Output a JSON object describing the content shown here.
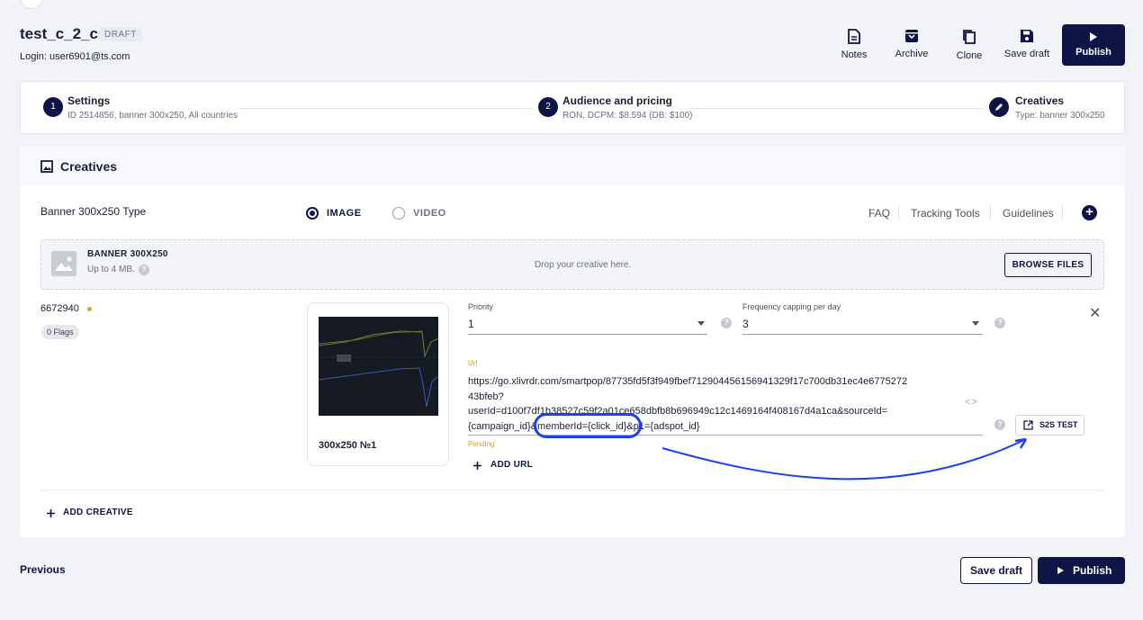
{
  "header": {
    "campaign_name": "test_c_2_c",
    "status_badge": "DRAFT",
    "login": "Login: user6901@ts.com"
  },
  "toolbar": {
    "notes": "Notes",
    "archive": "Archive",
    "clone": "Clone",
    "save_draft": "Save draft",
    "publish": "Publish"
  },
  "steps": [
    {
      "number": "1",
      "title": "Settings",
      "subtitle": "ID 2514856, banner 300x250, All countries"
    },
    {
      "number": "2",
      "title": "Audience and pricing",
      "subtitle": "RON, DCPM: $8.594 (DB: $100)"
    },
    {
      "number": "",
      "title": "Creatives",
      "subtitle": "Type: banner 300x250"
    }
  ],
  "creatives": {
    "section_title": "Creatives",
    "type_label": "Banner 300x250 Type",
    "format_options": [
      {
        "label": "IMAGE",
        "selected": true
      },
      {
        "label": "VIDEO",
        "selected": false
      }
    ],
    "links": [
      "FAQ",
      "Tracking Tools",
      "Guidelines"
    ],
    "dropzone": {
      "title": "BANNER 300X250",
      "subtitle": "Up to 4 MB.",
      "hint": "Drop your creative here.",
      "browse": "BROWSE FILES"
    },
    "item": {
      "id": "6672940",
      "flags": "0 Flags",
      "card_label": "300x250 №1",
      "priority_label": "Priority",
      "priority_value": "1",
      "freq_label": "Frequency capping per day",
      "freq_value": "3",
      "url_label": "Url",
      "url_line1": "https://go.xlivrdr.com/smartpop/87735fd5f3f949fbef712904456156941329f17c700db31ec4e6775272",
      "url_line2": "43bfeb?",
      "url_line3": "userId=d100f7df1b38527c59f2a01ce658dbfb8b696949c12c1469164f408167d4a1ca&sourceId=",
      "url_line4": "{campaign_id}&memberId={click_id}&p1={adspot_id}",
      "url_status": "Pending",
      "s2s_test": "S2S TEST",
      "add_url": "ADD URL"
    },
    "add_creative": "ADD CREATIVE"
  },
  "footer": {
    "previous": "Previous",
    "save_draft": "Save draft",
    "publish": "Publish"
  },
  "colors": {
    "primary": "#0e1446",
    "pending": "#d9a000",
    "annotation": "#1d3ff0"
  }
}
